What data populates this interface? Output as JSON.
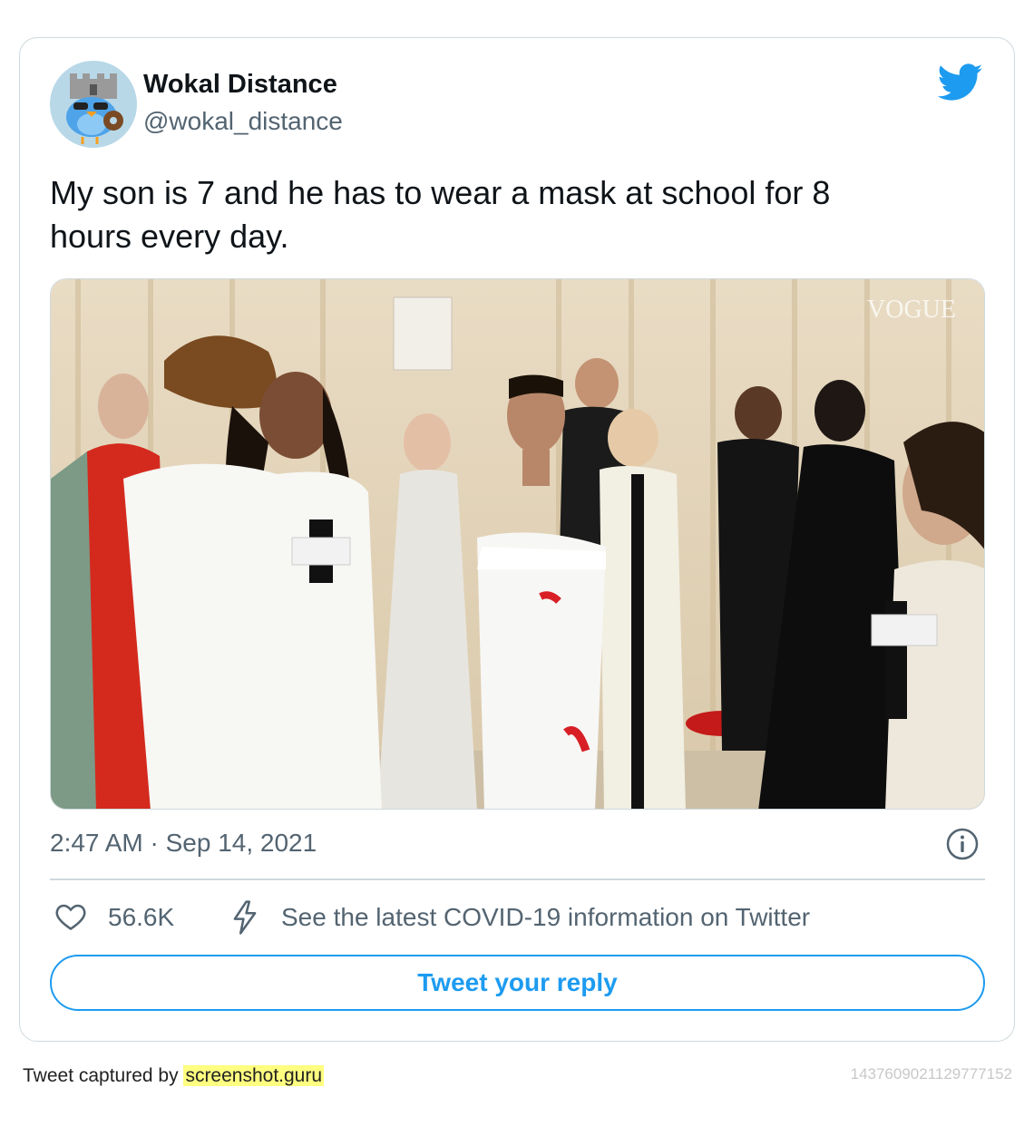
{
  "tweet": {
    "author_name": "Wokal Distance",
    "author_handle": "@wokal_distance",
    "text": "My son is 7 and he has to wear a mask at school for 8\nhours every day.",
    "media_watermark": "VOGUE",
    "mic_flag_label": "VOGUE",
    "timestamp": "2:47 AM · Sep 14, 2021",
    "likes": "56.6K",
    "covid_info": "See the latest COVID-19 information on Twitter",
    "reply_button": "Tweet your reply"
  },
  "footer": {
    "captured_prefix": "Tweet captured by ",
    "captured_site": "screenshot.guru",
    "tweet_id": "1437609021129777152"
  },
  "icons": {
    "brand": "twitter-bird-icon",
    "info": "info-circle-icon",
    "like": "heart-icon",
    "covid": "lightning-bolt-icon"
  },
  "colors": {
    "twitter_blue": "#1d9bf0",
    "text_primary": "#0f1419",
    "text_secondary": "#536471",
    "border": "#cfd9de",
    "highlight": "#ffff80"
  }
}
